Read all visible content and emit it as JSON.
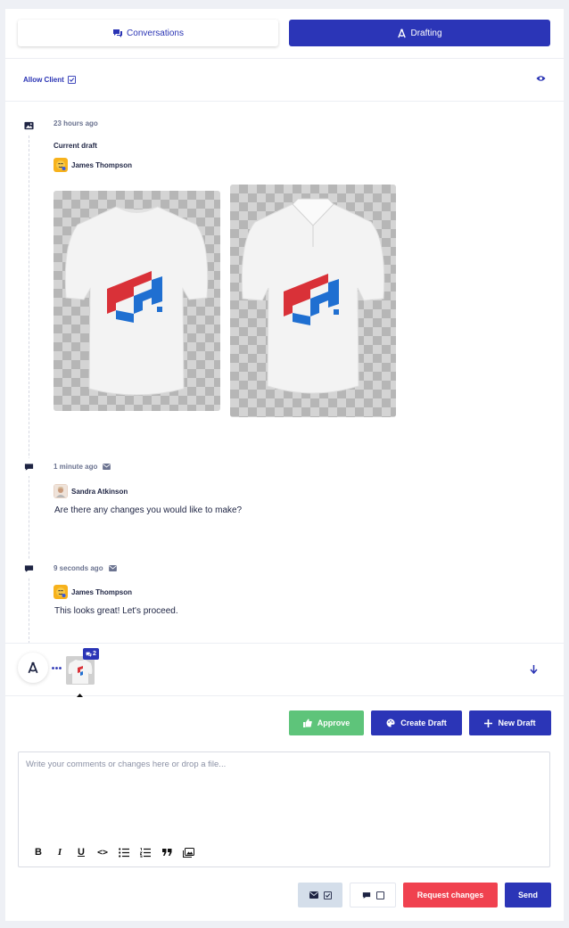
{
  "tabs": [
    {
      "label": "Conversations",
      "icon": "comments-icon",
      "active": false
    },
    {
      "label": "Drafting",
      "icon": "drafting-compass-icon",
      "active": true
    }
  ],
  "allow_client": {
    "label": "Allow Client",
    "checked": true
  },
  "timeline": {
    "draft_entry": {
      "time": "23 hours ago",
      "label": "Current draft",
      "author": "James Thompson"
    },
    "message_1": {
      "time": "1 minute ago",
      "author": "Sandra Atkinson",
      "text": "Are there any changes you would like to make?"
    },
    "message_2": {
      "time": "9 seconds ago",
      "author": "James Thompson",
      "text": "This looks great! Let's proceed."
    }
  },
  "draft_thumb": {
    "comment_count": "2"
  },
  "actions": {
    "approve": "Approve",
    "create_draft": "Create Draft",
    "new_draft": "New Draft"
  },
  "editor": {
    "placeholder": "Write your comments or changes here or drop a file...",
    "toolbar": [
      "B",
      "I",
      "U",
      "<>",
      "bullet-list",
      "numbered-list",
      "quote",
      "image"
    ]
  },
  "footer": {
    "request_changes": "Request changes",
    "send": "Send"
  },
  "colors": {
    "primary": "#2b35b7",
    "approve": "#5ec47a",
    "danger": "#f0414f",
    "logo_red": "#d93138",
    "logo_blue": "#1f6fd1"
  }
}
